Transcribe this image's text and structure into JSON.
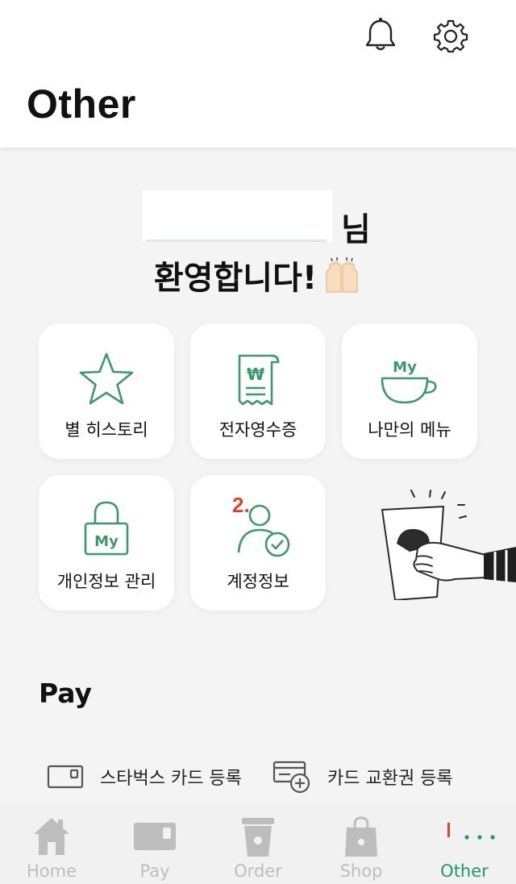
{
  "header": {
    "title": "Other",
    "notification_icon": "bell-icon",
    "settings_icon": "gear-icon"
  },
  "welcome": {
    "suffix": "님",
    "greeting": "환영합니다!",
    "emoji": "raised-hands-icon"
  },
  "tiles": [
    {
      "label": "별 히스토리",
      "icon": "star-icon"
    },
    {
      "label": "전자영수증",
      "icon": "receipt-icon",
      "icon_text": "₩"
    },
    {
      "label": "나만의 메뉴",
      "icon": "my-cup-icon",
      "icon_text": "My"
    },
    {
      "label": "개인정보 관리",
      "icon": "lock-icon",
      "icon_text": "My"
    },
    {
      "label": "계정정보",
      "icon": "account-icon",
      "badge": "2."
    }
  ],
  "pay": {
    "title": "Pay",
    "items": [
      {
        "label": "스타벅스 카드 등록",
        "icon": "card-icon"
      },
      {
        "label": "카드 교환권 등록",
        "icon": "card-add-icon"
      }
    ]
  },
  "nav": {
    "items": [
      {
        "label": "Home",
        "icon": "home-icon"
      },
      {
        "label": "Pay",
        "icon": "pay-card-icon"
      },
      {
        "label": "Order",
        "icon": "cup-icon"
      },
      {
        "label": "Shop",
        "icon": "bag-icon"
      },
      {
        "label": "Other",
        "icon": "more-dots-icon",
        "active": true
      }
    ]
  },
  "colors": {
    "accent": "#1e9a62",
    "tile_icon": "#3c9a6a",
    "badge": "#e0432e",
    "inactive": "#bdbdbd"
  }
}
